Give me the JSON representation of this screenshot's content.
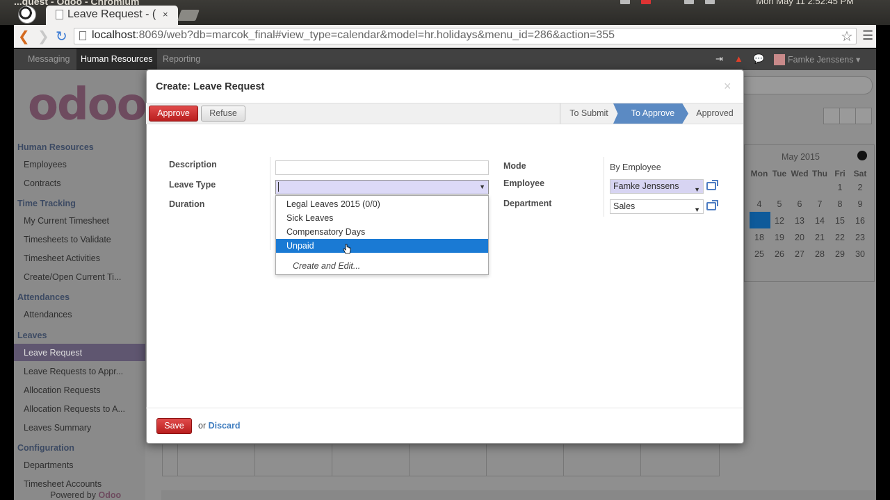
{
  "os": {
    "window_title": "...quest - Odoo - Chromium",
    "clock": "Mon May 11 2:52:45 PM"
  },
  "browser": {
    "tab_title": "Leave Request - (",
    "tab_close": "×",
    "url_host": "localhost",
    "url_rest": ":8069/web?db=marcok_final#view_type=calendar&model=hr.holidays&menu_id=286&action=355"
  },
  "topbar": {
    "menus": [
      "Messaging",
      "Human Resources",
      "Reporting"
    ],
    "user": "Famke Jenssens"
  },
  "logo": "odoo",
  "sidebar": {
    "sections": [
      {
        "title": "Human Resources",
        "items": [
          "Employees",
          "Contracts"
        ]
      },
      {
        "title": "Time Tracking",
        "items": [
          "My Current Timesheet",
          "Timesheets to Validate",
          "Timesheet Activities",
          "Create/Open Current Ti..."
        ]
      },
      {
        "title": "Attendances",
        "items": [
          "Attendances"
        ]
      },
      {
        "title": "Leaves",
        "items": [
          "Leave Request",
          "Leave Requests to Appr...",
          "Allocation Requests",
          "Allocation Requests to A...",
          "Leaves Summary"
        ]
      },
      {
        "title": "Configuration",
        "items": [
          "Departments",
          "Timesheet Accounts"
        ]
      }
    ],
    "active_item": "Leave Request",
    "powered_by": "Powered by",
    "powered_brand": "Odoo"
  },
  "calendar": {
    "month": "May 2015",
    "days_of_week": [
      "Mon",
      "Tue",
      "Wed",
      "Thu",
      "Fri",
      "Sat"
    ],
    "weeks": [
      [
        "",
        "",
        "",
        "",
        "1",
        "2"
      ],
      [
        "4",
        "5",
        "6",
        "7",
        "8",
        "9"
      ],
      [
        "11",
        "12",
        "13",
        "14",
        "15",
        "16"
      ],
      [
        "18",
        "19",
        "20",
        "21",
        "22",
        "23"
      ],
      [
        "25",
        "26",
        "27",
        "28",
        "29",
        "30"
      ]
    ],
    "today": "11"
  },
  "modal": {
    "title": "Create: Leave Request",
    "close": "×",
    "approve_label": "Approve",
    "refuse_label": "Refuse",
    "stages": [
      "To Submit",
      "To Approve",
      "Approved"
    ],
    "active_stage": "To Approve",
    "fields": {
      "description_label": "Description",
      "description_value": "",
      "leave_type_label": "Leave Type",
      "leave_type_value": "",
      "duration_label": "Duration",
      "mode_label": "Mode",
      "mode_value": "By Employee",
      "employee_label": "Employee",
      "employee_value": "Famke Jenssens",
      "department_label": "Department",
      "department_value": "Sales"
    },
    "dropdown": {
      "options": [
        "Legal Leaves 2015 (0/0)",
        "Sick Leaves",
        "Compensatory Days",
        "Unpaid"
      ],
      "highlighted": "Unpaid",
      "create_edit": "Create and Edit..."
    },
    "save_label": "Save",
    "or_text": "or",
    "discard_label": "Discard"
  },
  "colors": {
    "accent_red": "#c9302c",
    "stage_active": "#5b8ac3",
    "highlight": "#1a7ad4"
  }
}
